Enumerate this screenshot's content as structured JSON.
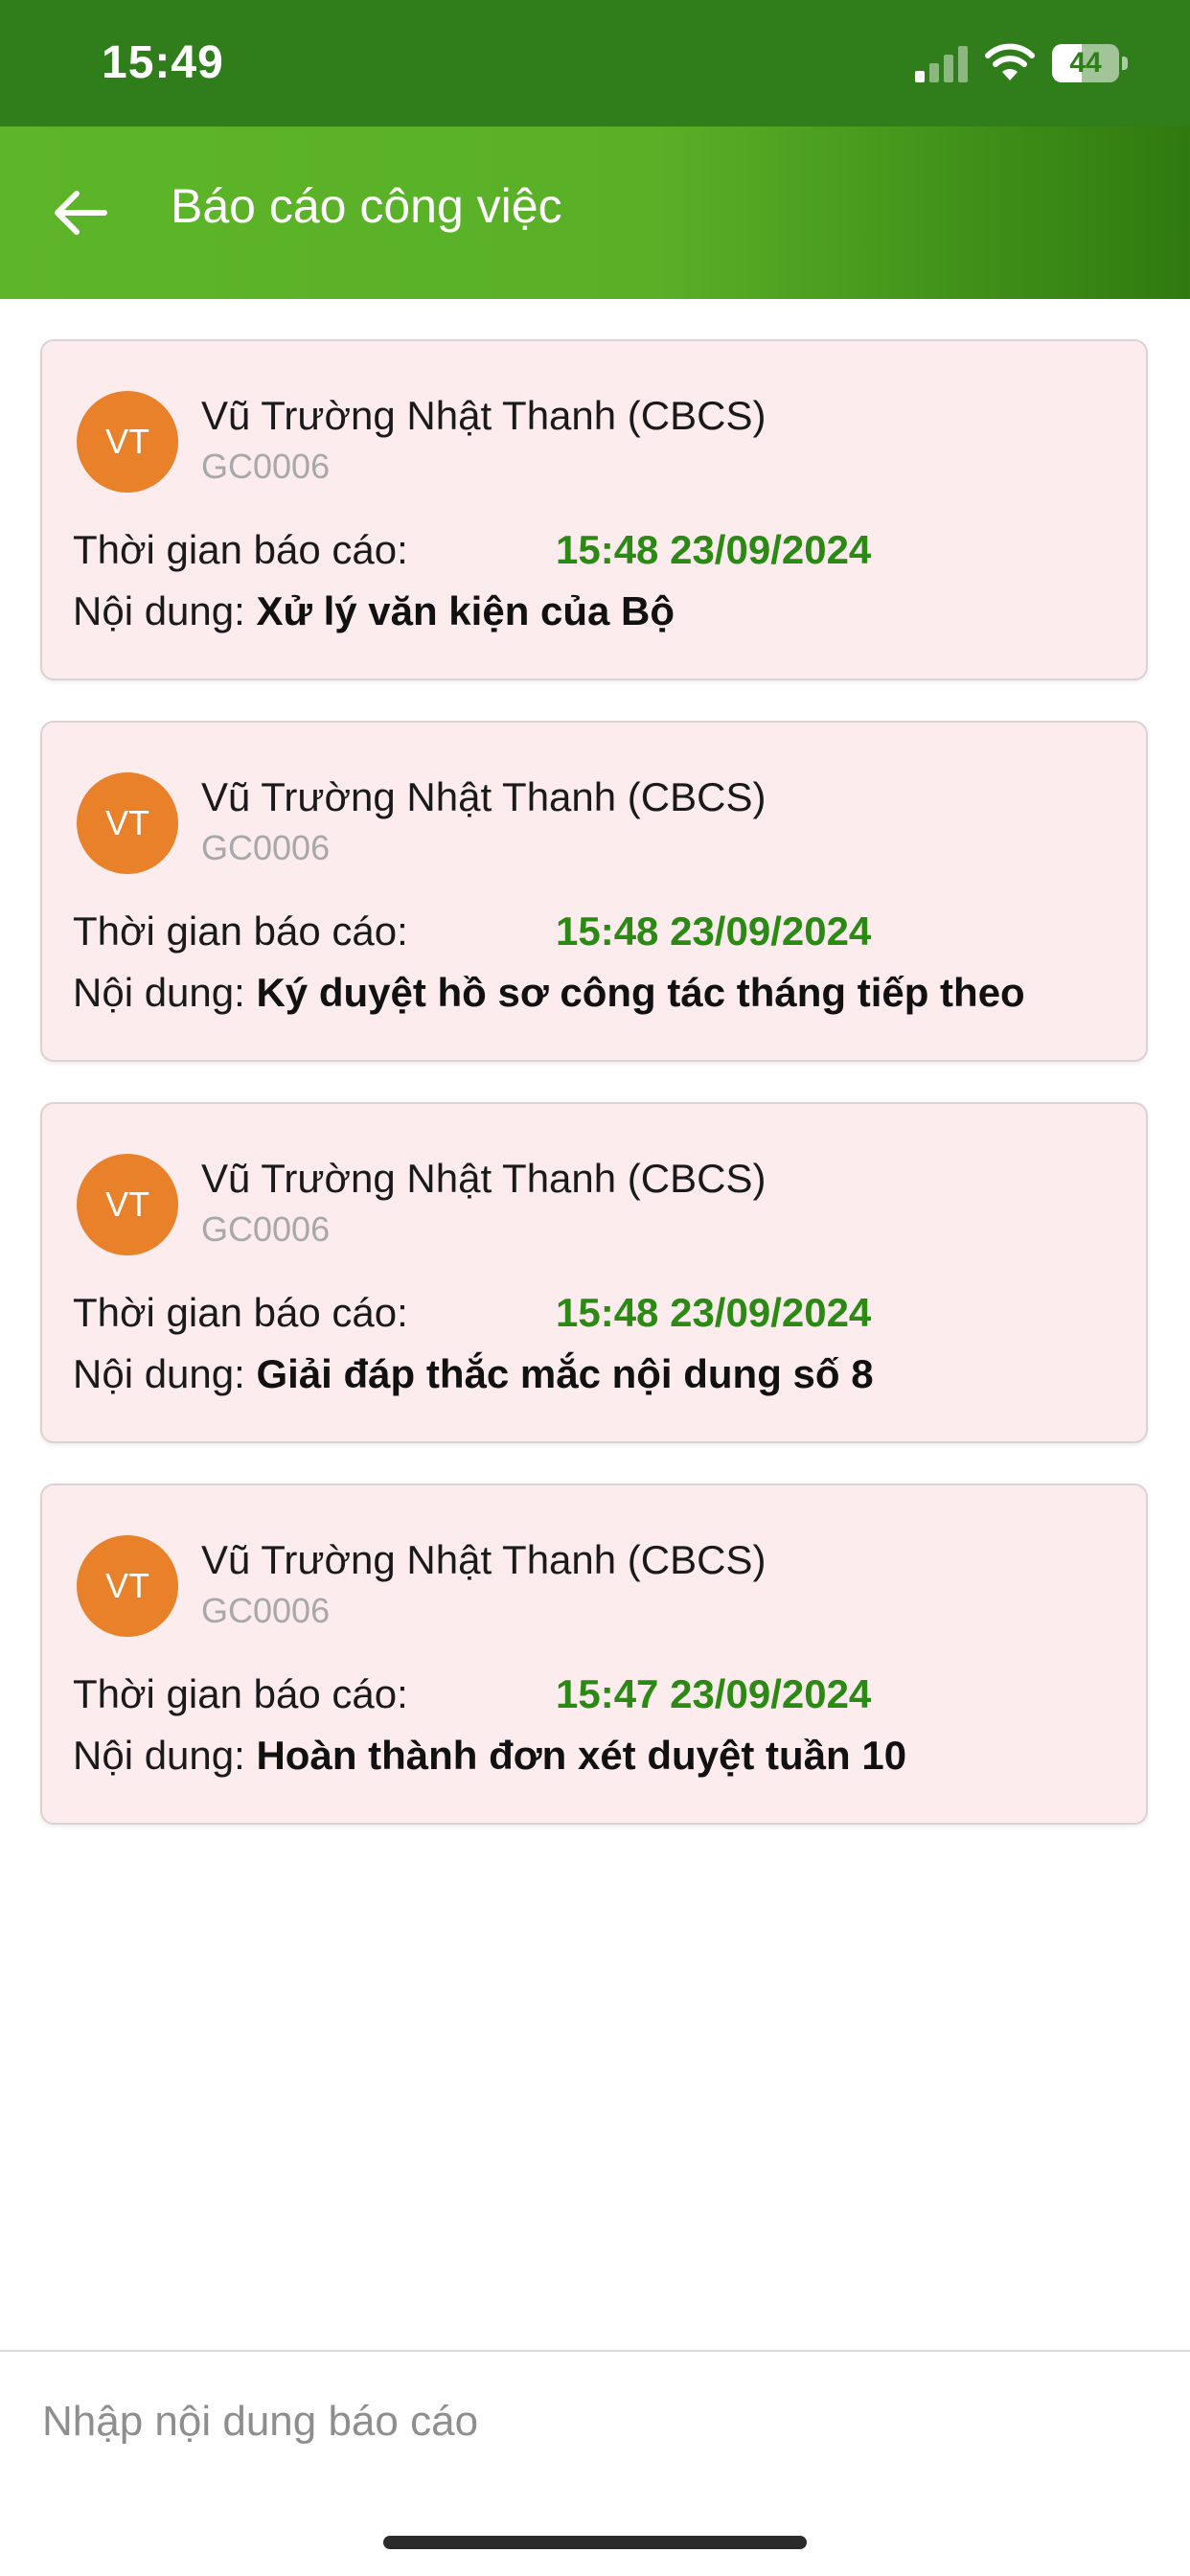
{
  "status_bar": {
    "time": "15:49",
    "battery_level": "44",
    "battery_fraction": 0.44,
    "signal_bars_active": 1,
    "signal_bars_total": 4
  },
  "app_bar": {
    "title": "Báo cáo công việc",
    "back_icon": "arrow-left-icon"
  },
  "reports": [
    {
      "avatar_initials": "VT",
      "name": "Vũ Trường Nhật Thanh (CBCS)",
      "code": "GC0006",
      "time_label": "Thời gian báo cáo:",
      "time_value": "15:48 23/09/2024",
      "content_label": "Nội dung:",
      "content_value": "Xử lý văn kiện của Bộ"
    },
    {
      "avatar_initials": "VT",
      "name": "Vũ Trường Nhật Thanh (CBCS)",
      "code": "GC0006",
      "time_label": "Thời gian báo cáo:",
      "time_value": "15:48 23/09/2024",
      "content_label": "Nội dung:",
      "content_value": "Ký duyệt hồ sơ công tác tháng tiếp theo"
    },
    {
      "avatar_initials": "VT",
      "name": "Vũ Trường Nhật Thanh (CBCS)",
      "code": "GC0006",
      "time_label": "Thời gian báo cáo:",
      "time_value": "15:48 23/09/2024",
      "content_label": "Nội dung:",
      "content_value": "Giải đáp thắc mắc nội dung số 8"
    },
    {
      "avatar_initials": "VT",
      "name": "Vũ Trường Nhật Thanh (CBCS)",
      "code": "GC0006",
      "time_label": "Thời gian báo cáo:",
      "time_value": "15:47 23/09/2024",
      "content_label": "Nội dung:",
      "content_value": "Hoàn thành đơn xét duyệt tuần 10"
    }
  ],
  "input": {
    "placeholder": "Nhập nội dung báo cáo",
    "value": ""
  },
  "colors": {
    "status_bar": "#2f7d1b",
    "app_bar_start": "#5db529",
    "app_bar_end": "#2f7a0f",
    "card_background": "#fdecee",
    "avatar": "#e8812a",
    "time_value": "#2b8a14"
  }
}
